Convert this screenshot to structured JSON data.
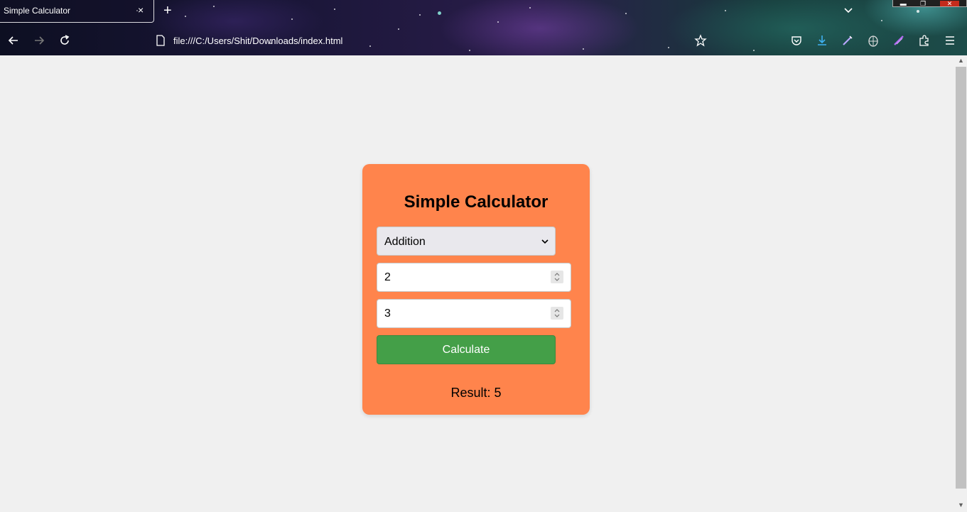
{
  "browser": {
    "tab_title": "Simple Calculator",
    "tab_close": "×",
    "new_tab": "+",
    "url": "file:///C:/Users/Shit/Downloads/index.html"
  },
  "icons": {
    "back": "back-arrow-icon",
    "forward": "forward-arrow-icon",
    "reload": "reload-icon",
    "page": "page-icon",
    "bookmark": "star-icon",
    "pocket": "pocket-icon",
    "downloads": "download-icon",
    "extensions": "puzzle-icon",
    "menu": "hamburger-menu-icon"
  },
  "calculator": {
    "title": "Simple Calculator",
    "operation": {
      "selected": "Addition"
    },
    "first_number": "2",
    "second_number": "3",
    "calculate_label": "Calculate",
    "result_text": "Result: 5"
  },
  "colors": {
    "card": "#ff844c",
    "button": "#449f48",
    "page_bg": "#f0f0f0",
    "download_accent": "#3fb1f2"
  }
}
